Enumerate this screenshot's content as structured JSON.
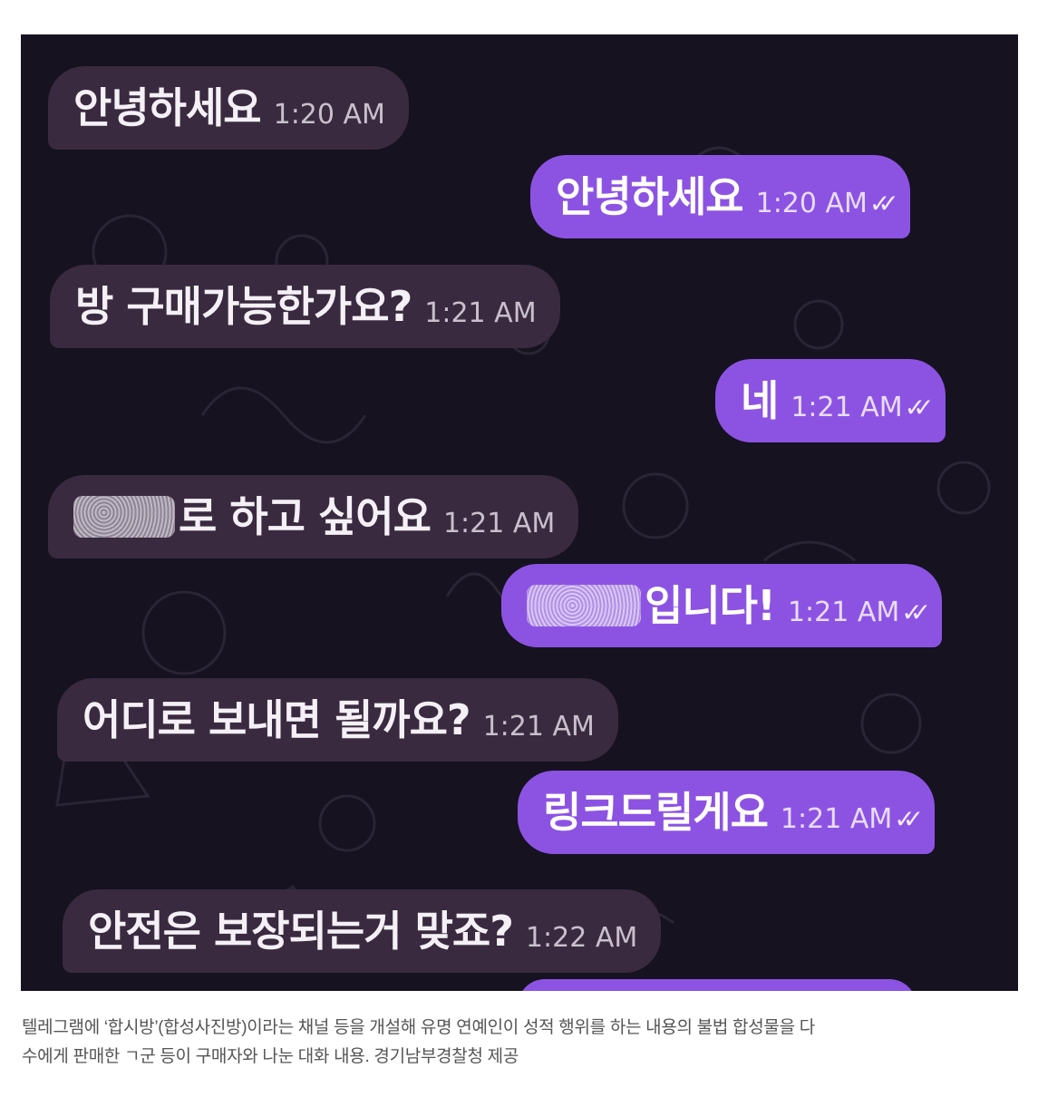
{
  "messages": [
    {
      "dir": "in",
      "text": "안녕하세요",
      "time": "1:20 AM",
      "check": ""
    },
    {
      "dir": "out",
      "text": "안녕하세요",
      "time": "1:20 AM",
      "check": "✓✓"
    },
    {
      "dir": "in",
      "text": "방 구매가능한가요?",
      "time": "1:21 AM",
      "check": ""
    },
    {
      "dir": "out",
      "text": "네",
      "time": "1:21 AM",
      "check": "✓✓"
    },
    {
      "dir": "in",
      "text": "로 하고 싶어요",
      "time": "1:21 AM",
      "check": ""
    },
    {
      "dir": "out",
      "text": "입니다!",
      "time": "1:21 AM",
      "check": "✓✓"
    },
    {
      "dir": "in",
      "text": "어디로 보내면 될까요?",
      "time": "1:21 AM",
      "check": ""
    },
    {
      "dir": "out",
      "text": "링크드릴게요",
      "time": "1:21 AM",
      "check": "✓✓"
    },
    {
      "dir": "in",
      "text": "안전은 보장되는거 맞죠?",
      "time": "1:22 AM",
      "check": ""
    }
  ],
  "colors": {
    "background": "#161220",
    "incoming_bubble": "#3a2a3f",
    "outgoing_bubble": "#8c53e3"
  },
  "caption": {
    "line1": "텔레그램에 ‘합시방’(합성사진방)이라는 채널 등을 개설해 유명 연예인이 성적 행위를 하는 내용의 불법 합성물을 다",
    "line2": "수에게 판매한 ㄱ군 등이 구매자와 나눈 대화 내용. 경기남부경찰청 제공"
  }
}
